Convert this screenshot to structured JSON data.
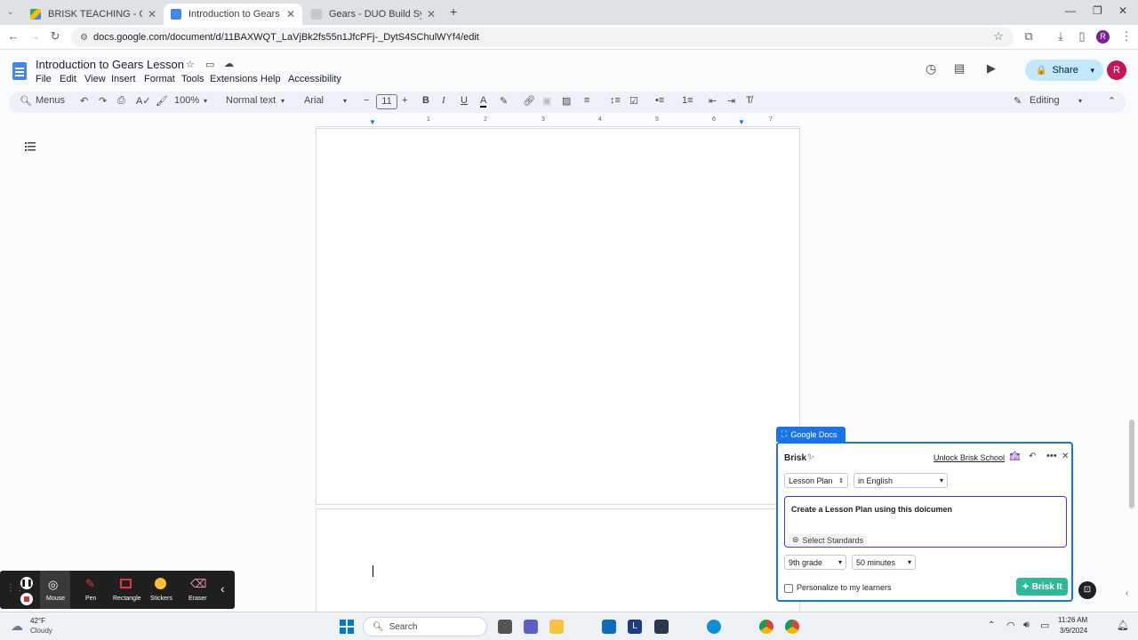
{
  "browser": {
    "tabs": [
      {
        "title": "BRISK TEACHING - Google Driv",
        "active": false
      },
      {
        "title": "Introduction to Gears Lesson -",
        "active": true
      },
      {
        "title": "Gears - DUO Build System",
        "active": false
      }
    ],
    "url": "docs.google.com/document/d/11BAXWQT_LaVjBk2fs55n1JfcPFj-_DytS4SChulWYf4/edit"
  },
  "docs": {
    "title": "Introduction to Gears Lesson",
    "menus": [
      "File",
      "Edit",
      "View",
      "Insert",
      "Format",
      "Tools",
      "Extensions",
      "Help",
      "Accessibility"
    ],
    "share_label": "Share",
    "avatar_letter": "R",
    "toolbar": {
      "search_menus": "Menus",
      "zoom": "100%",
      "style": "Normal text",
      "font": "Arial",
      "font_size": "11",
      "mode": "Editing"
    },
    "ruler_numbers": [
      "1",
      "2",
      "3",
      "4",
      "5",
      "6",
      "7"
    ]
  },
  "brisk": {
    "tag": "Google Docs",
    "title": "Brisk",
    "unlock": "Unlock Brisk School",
    "type": "Lesson Plan",
    "language": "in English",
    "prompt": "Create a Lesson Plan using this doicumen",
    "standards": "Select Standards",
    "grade": "9th grade",
    "duration": "50 minutes",
    "personalize": "Personalize to my learners",
    "submit": "Brisk It"
  },
  "recorder": {
    "tools": [
      "Mouse",
      "Pen",
      "Rectangle",
      "Stickers",
      "Eraser"
    ]
  },
  "taskbar": {
    "temp": "42°F",
    "weather": "Cloudy",
    "search": "Search",
    "time": "11:26 AM",
    "date": "3/9/2024"
  }
}
